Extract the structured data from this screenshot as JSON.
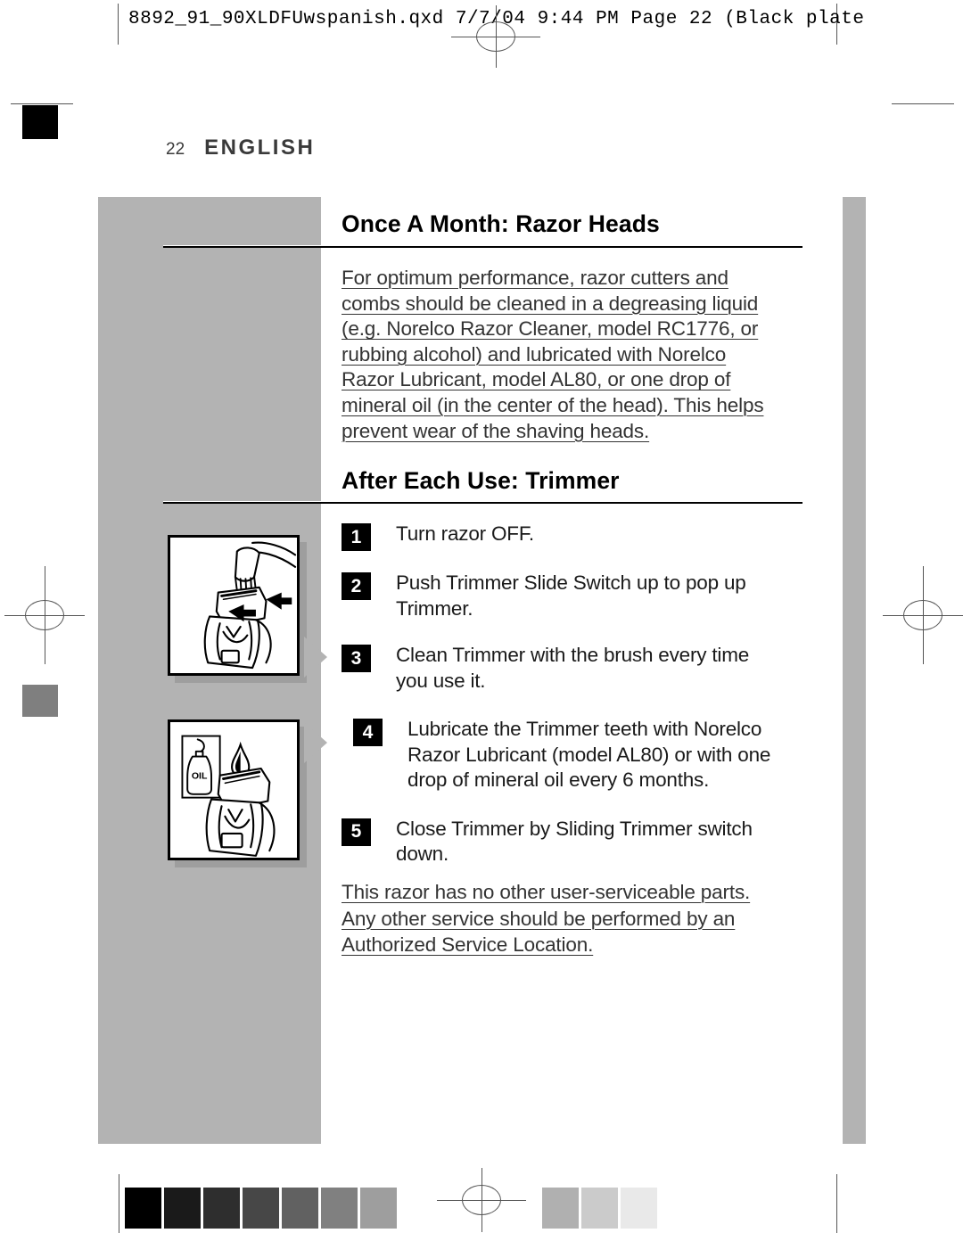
{
  "prepress": {
    "header_line": "8892_91_90XLDFUwspanish.qxd   7/7/04   9:44 PM   Page 22      (Black plate",
    "filename": "8892_91_90XLDFUwspanish.qxd",
    "date": "7/7/04",
    "time": "9:44 PM",
    "page_marker": "Page 22",
    "plate": "(Black plate"
  },
  "page": {
    "number": "22",
    "language": "ENGLISH"
  },
  "sections": [
    {
      "title": "Once A Month:  Razor Heads",
      "paragraph_lines": [
        "For optimum performance, razor cutters and",
        "combs should be cleaned in a degreasing liquid",
        "(e.g. Norelco Razor Cleaner, model RC1776, or",
        "rubbing alcohol) and lubricated with Norelco",
        "Razor Lubricant, model AL80, or one drop of",
        "mineral oil (in the center of the head). This helps",
        "prevent wear of the shaving heads."
      ]
    },
    {
      "title": "After Each Use:  Trimmer"
    }
  ],
  "steps": [
    {
      "number": "1",
      "lines": [
        "Turn razor OFF."
      ]
    },
    {
      "number": "2",
      "lines": [
        "Push Trimmer Slide Switch up to pop up",
        "Trimmer."
      ]
    },
    {
      "number": "3",
      "lines": [
        "Clean Trimmer with the brush every time",
        "you use it."
      ]
    },
    {
      "number": "4",
      "lines": [
        "Lubricate the Trimmer teeth with Norelco",
        "Razor Lubricant (model AL80) or with one",
        "drop of mineral oil every 6 months."
      ]
    },
    {
      "number": "5",
      "lines": [
        "Close Trimmer by Sliding Trimmer switch",
        "down."
      ]
    }
  ],
  "closing_lines": [
    "This razor has no other user-serviceable parts.",
    "Any other service should be performed by an",
    "Authorized Service Location."
  ],
  "illustrations": [
    {
      "caption_hint": "brush-cleaning-trimmer",
      "label": ""
    },
    {
      "caption_hint": "oil-drop-on-trimmer",
      "label": "OIL"
    }
  ],
  "colors": {
    "band_gray": "#b3b3b3",
    "text_black": "#000000",
    "body_gray": "#333333",
    "shadow_gray": "#9e9e9e",
    "swatch_black": "#000000",
    "swatch_gray": "#7f7f7f"
  },
  "calibration_swatches_left": [
    "#000000",
    "#1a1a1a",
    "#2e2e2e",
    "#474747",
    "#616161",
    "#808080",
    "#9e9e9e"
  ],
  "calibration_swatches_right": [
    "#b0b0b0",
    "#cbcbcb",
    "#e9e9e9"
  ]
}
